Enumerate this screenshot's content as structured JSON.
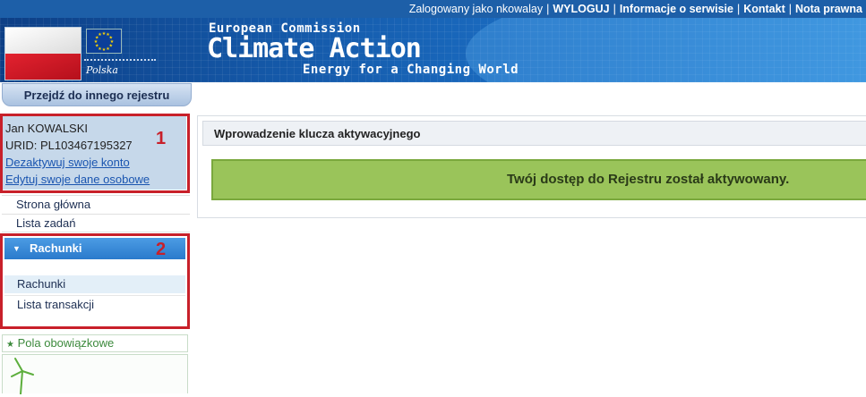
{
  "topbar": {
    "logged_as_label": "Zalogowany jako",
    "username": "nkowalay",
    "logout": "WYLOGUJ",
    "about": "Informacje o serwisie",
    "contact": "Kontakt",
    "legal": "Nota prawna",
    "separator": "|"
  },
  "banner": {
    "country": "Polska",
    "org": "European Commission",
    "title": "Climate Action",
    "tagline": "Energy for a Changing World"
  },
  "sidebar": {
    "switch_registry": "Przejdź do innego rejestru",
    "user": {
      "name": "Jan KOWALSKI",
      "urid": "URID: PL103467195327",
      "deactivate": "Dezaktywuj swoje konto",
      "edit": "Edytuj swoje dane osobowe"
    },
    "nav": [
      "Strona główna",
      "Lista zadań"
    ],
    "accounts_section": {
      "title": "Rachunki",
      "items": [
        "Rachunki",
        "Lista transakcji"
      ],
      "active_index": 0
    },
    "required_fields": "Pola obowiązkowe"
  },
  "annotations": [
    "1",
    "2"
  ],
  "main": {
    "panel_title": "Wprowadzenie klucza aktywacyjnego",
    "success_message": "Twój dostęp do Rejestru został aktywowany."
  },
  "colors": {
    "topbar": "#1d5fa8",
    "annotation_red": "#c8202a",
    "success_bg": "#9ac45a",
    "user_box_bg": "#c6d8ea"
  }
}
